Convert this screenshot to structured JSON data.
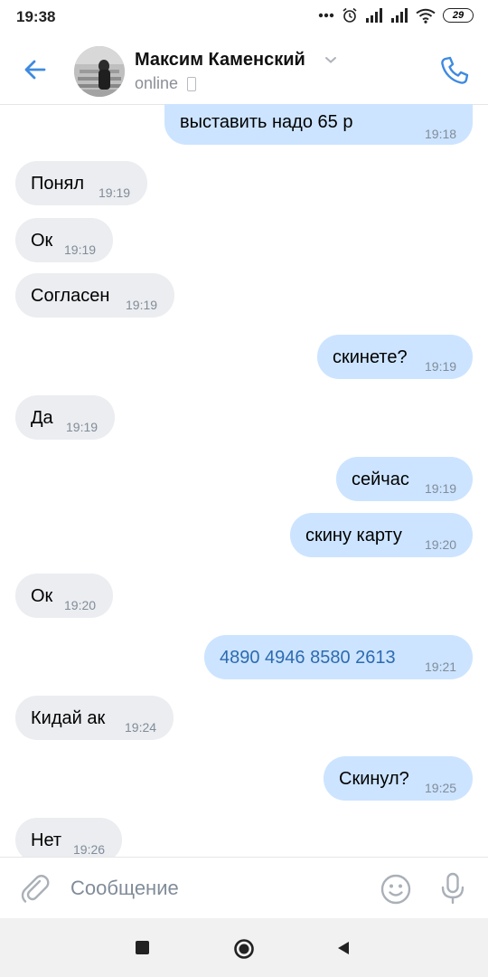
{
  "status_bar": {
    "time": "19:38",
    "battery": "29"
  },
  "header": {
    "contact_name": "Максим Каменский",
    "status": "online"
  },
  "messages": [
    {
      "dir": "out",
      "text": "выставить надо 65 р",
      "time": "19:18"
    },
    {
      "dir": "in",
      "text": "Понял",
      "time": "19:19"
    },
    {
      "dir": "in",
      "text": "Ок",
      "time": "19:19"
    },
    {
      "dir": "in",
      "text": "Согласен",
      "time": "19:19"
    },
    {
      "dir": "out",
      "text": "скинете?",
      "time": "19:19"
    },
    {
      "dir": "in",
      "text": "Да",
      "time": "19:19"
    },
    {
      "dir": "out",
      "text": "сейчас",
      "time": "19:19"
    },
    {
      "dir": "out",
      "text": "скину карту",
      "time": "19:20"
    },
    {
      "dir": "in",
      "text": "Ок",
      "time": "19:20"
    },
    {
      "dir": "out",
      "text": "4890 4946 8580 2613",
      "time": "19:21",
      "link": true
    },
    {
      "dir": "in",
      "text": "Кидай ак",
      "time": "19:24"
    },
    {
      "dir": "out",
      "text": "Скинул?",
      "time": "19:25"
    },
    {
      "dir": "in",
      "text": "Нет",
      "time": "19:26"
    }
  ],
  "composer": {
    "placeholder": "Сообщение"
  },
  "icons": {
    "back": "back-arrow-icon",
    "call": "phone-icon",
    "attach": "paperclip-icon",
    "emoji": "smiley-icon",
    "mic": "microphone-icon"
  },
  "colors": {
    "accent": "#3f8ae0",
    "incoming_bubble": "#ebedf0",
    "outgoing_bubble": "#cce4ff",
    "time_text": "#818c99"
  }
}
